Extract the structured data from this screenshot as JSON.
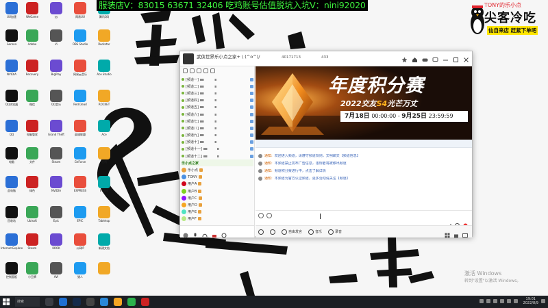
{
  "overlay": {
    "banner": "服装店V：83015 63671 32406 吃鸡账号估值脱坑入坑V：nini92020"
  },
  "brand": {
    "top": "TONY的乐小点",
    "name": "尖客冷吃",
    "slogan": "仙自来店 赶紧下单吧"
  },
  "desktop": {
    "icons": [
      "UU加速",
      "WeGame",
      "yy",
      "网易UU",
      "腾讯QQ",
      "Garena",
      "Adobe",
      "Vi",
      "OBS Studio",
      "Rockstar",
      "NVIDIA",
      "Recovery",
      "BigPlay",
      "网易云音乐",
      "Ace Studio",
      "QQ浏览器",
      "微信",
      "QQ音乐",
      "Red Dead",
      "ROCKET",
      "QQ",
      "电脑管家",
      "Grand Theft",
      "英雄联盟",
      "Ace",
      "电脑",
      "文件",
      "Steam",
      "GeForce",
      "吃鸡",
      "此电脑",
      "绿色",
      "NVIDIA",
      "EXPRESS",
      "Inside",
      "回收站",
      "Ubisoft",
      "Epic",
      "EPIC",
      "Tabletop",
      "Internet Explorer",
      "Steam",
      "KOOK",
      "公网IP",
      "新建文档",
      "控制面板",
      "小丑牌",
      "AVI",
      "猎人",
      "",
      "QQ",
      "LOL",
      "PUBG",
      "Red Dead",
      "",
      "网络",
      "文档",
      "Diablo",
      "Red Dead",
      ""
    ]
  },
  "app": {
    "channel_name": "武侠世界乐小点之家+ \\ (^o^)/",
    "channel_id": "40171713",
    "online_count": "433",
    "sidebar_section": "乐小点之家",
    "tree_rows": [
      "[频道一]",
      "[频道二]",
      "[频道三]",
      "[频道四]",
      "[频道五]",
      "[频道六]",
      "[频道七]",
      "[频道八]",
      "[频道九]",
      "[频道十]",
      "[频道十一]",
      "[频道十二]"
    ],
    "users": [
      "乐小点",
      "TONY",
      "用户A",
      "用户B",
      "用户C",
      "用户D",
      "用户E",
      "用户F"
    ],
    "banner": {
      "title": "年度积分赛",
      "sub_prefix": "2022交友",
      "sub_highlight": "S4",
      "sub_suffix": "光芒万丈",
      "date_start": "7月18日",
      "time_start": "00:00:00",
      "sep": "-",
      "date_end": "9月25日",
      "time_end": "23:59:59"
    },
    "chat": [
      {
        "who": "通知:",
        "text": "欢迎进入频道，请遵守频道规则，文明聊天【频道信息】"
      },
      {
        "who": "通知:",
        "text": "本频道禁止发布广告信息，违规者将被移出频道"
      },
      {
        "who": "通知:",
        "text": "频道积分赛进行中，点击了解详情"
      },
      {
        "who": "通知:",
        "text": "本频道为官方认证频道，更多活动请关注【频道】"
      }
    ],
    "footer": {
      "free_mic": "自由发言",
      "music": "音乐",
      "record": "录音"
    }
  },
  "watermark": {
    "line1": "激活 Windows",
    "line2": "转到\"设置\"以激活 Windows。"
  },
  "taskbar": {
    "search": "搜索",
    "time": "19:01",
    "date": "2022/8/9"
  }
}
